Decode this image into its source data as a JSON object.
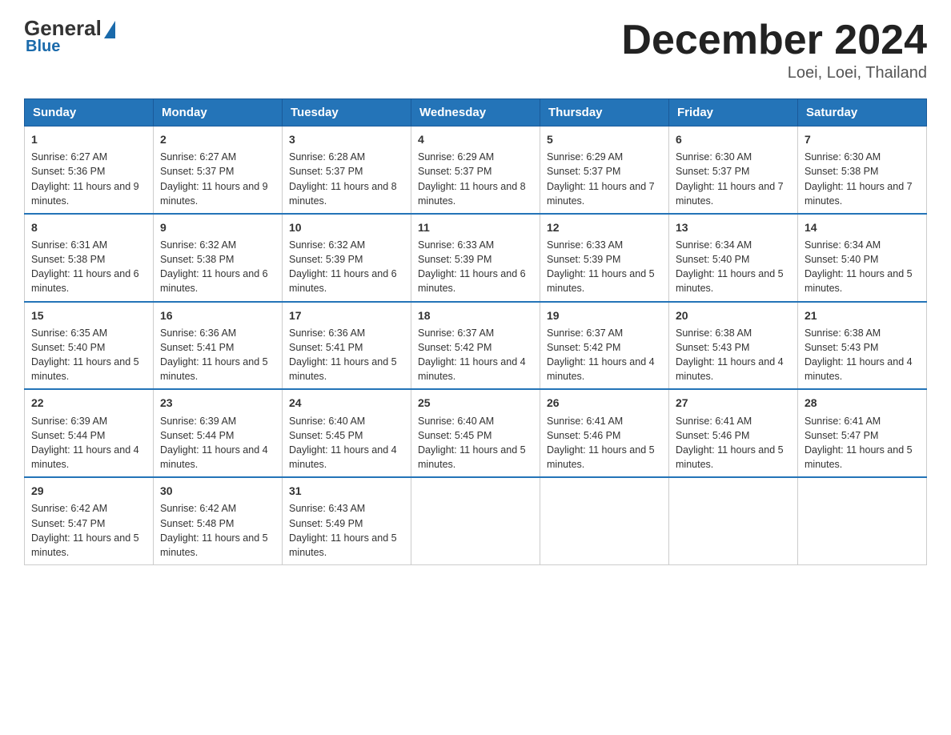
{
  "header": {
    "logo": {
      "general": "General",
      "blue": "Blue"
    },
    "title": "December 2024",
    "location": "Loei, Loei, Thailand"
  },
  "days_of_week": [
    "Sunday",
    "Monday",
    "Tuesday",
    "Wednesday",
    "Thursday",
    "Friday",
    "Saturday"
  ],
  "weeks": [
    [
      {
        "day": "1",
        "sunrise": "6:27 AM",
        "sunset": "5:36 PM",
        "daylight": "11 hours and 9 minutes."
      },
      {
        "day": "2",
        "sunrise": "6:27 AM",
        "sunset": "5:37 PM",
        "daylight": "11 hours and 9 minutes."
      },
      {
        "day": "3",
        "sunrise": "6:28 AM",
        "sunset": "5:37 PM",
        "daylight": "11 hours and 8 minutes."
      },
      {
        "day": "4",
        "sunrise": "6:29 AM",
        "sunset": "5:37 PM",
        "daylight": "11 hours and 8 minutes."
      },
      {
        "day": "5",
        "sunrise": "6:29 AM",
        "sunset": "5:37 PM",
        "daylight": "11 hours and 7 minutes."
      },
      {
        "day": "6",
        "sunrise": "6:30 AM",
        "sunset": "5:37 PM",
        "daylight": "11 hours and 7 minutes."
      },
      {
        "day": "7",
        "sunrise": "6:30 AM",
        "sunset": "5:38 PM",
        "daylight": "11 hours and 7 minutes."
      }
    ],
    [
      {
        "day": "8",
        "sunrise": "6:31 AM",
        "sunset": "5:38 PM",
        "daylight": "11 hours and 6 minutes."
      },
      {
        "day": "9",
        "sunrise": "6:32 AM",
        "sunset": "5:38 PM",
        "daylight": "11 hours and 6 minutes."
      },
      {
        "day": "10",
        "sunrise": "6:32 AM",
        "sunset": "5:39 PM",
        "daylight": "11 hours and 6 minutes."
      },
      {
        "day": "11",
        "sunrise": "6:33 AM",
        "sunset": "5:39 PM",
        "daylight": "11 hours and 6 minutes."
      },
      {
        "day": "12",
        "sunrise": "6:33 AM",
        "sunset": "5:39 PM",
        "daylight": "11 hours and 5 minutes."
      },
      {
        "day": "13",
        "sunrise": "6:34 AM",
        "sunset": "5:40 PM",
        "daylight": "11 hours and 5 minutes."
      },
      {
        "day": "14",
        "sunrise": "6:34 AM",
        "sunset": "5:40 PM",
        "daylight": "11 hours and 5 minutes."
      }
    ],
    [
      {
        "day": "15",
        "sunrise": "6:35 AM",
        "sunset": "5:40 PM",
        "daylight": "11 hours and 5 minutes."
      },
      {
        "day": "16",
        "sunrise": "6:36 AM",
        "sunset": "5:41 PM",
        "daylight": "11 hours and 5 minutes."
      },
      {
        "day": "17",
        "sunrise": "6:36 AM",
        "sunset": "5:41 PM",
        "daylight": "11 hours and 5 minutes."
      },
      {
        "day": "18",
        "sunrise": "6:37 AM",
        "sunset": "5:42 PM",
        "daylight": "11 hours and 4 minutes."
      },
      {
        "day": "19",
        "sunrise": "6:37 AM",
        "sunset": "5:42 PM",
        "daylight": "11 hours and 4 minutes."
      },
      {
        "day": "20",
        "sunrise": "6:38 AM",
        "sunset": "5:43 PM",
        "daylight": "11 hours and 4 minutes."
      },
      {
        "day": "21",
        "sunrise": "6:38 AM",
        "sunset": "5:43 PM",
        "daylight": "11 hours and 4 minutes."
      }
    ],
    [
      {
        "day": "22",
        "sunrise": "6:39 AM",
        "sunset": "5:44 PM",
        "daylight": "11 hours and 4 minutes."
      },
      {
        "day": "23",
        "sunrise": "6:39 AM",
        "sunset": "5:44 PM",
        "daylight": "11 hours and 4 minutes."
      },
      {
        "day": "24",
        "sunrise": "6:40 AM",
        "sunset": "5:45 PM",
        "daylight": "11 hours and 4 minutes."
      },
      {
        "day": "25",
        "sunrise": "6:40 AM",
        "sunset": "5:45 PM",
        "daylight": "11 hours and 5 minutes."
      },
      {
        "day": "26",
        "sunrise": "6:41 AM",
        "sunset": "5:46 PM",
        "daylight": "11 hours and 5 minutes."
      },
      {
        "day": "27",
        "sunrise": "6:41 AM",
        "sunset": "5:46 PM",
        "daylight": "11 hours and 5 minutes."
      },
      {
        "day": "28",
        "sunrise": "6:41 AM",
        "sunset": "5:47 PM",
        "daylight": "11 hours and 5 minutes."
      }
    ],
    [
      {
        "day": "29",
        "sunrise": "6:42 AM",
        "sunset": "5:47 PM",
        "daylight": "11 hours and 5 minutes."
      },
      {
        "day": "30",
        "sunrise": "6:42 AM",
        "sunset": "5:48 PM",
        "daylight": "11 hours and 5 minutes."
      },
      {
        "day": "31",
        "sunrise": "6:43 AM",
        "sunset": "5:49 PM",
        "daylight": "11 hours and 5 minutes."
      },
      null,
      null,
      null,
      null
    ]
  ]
}
